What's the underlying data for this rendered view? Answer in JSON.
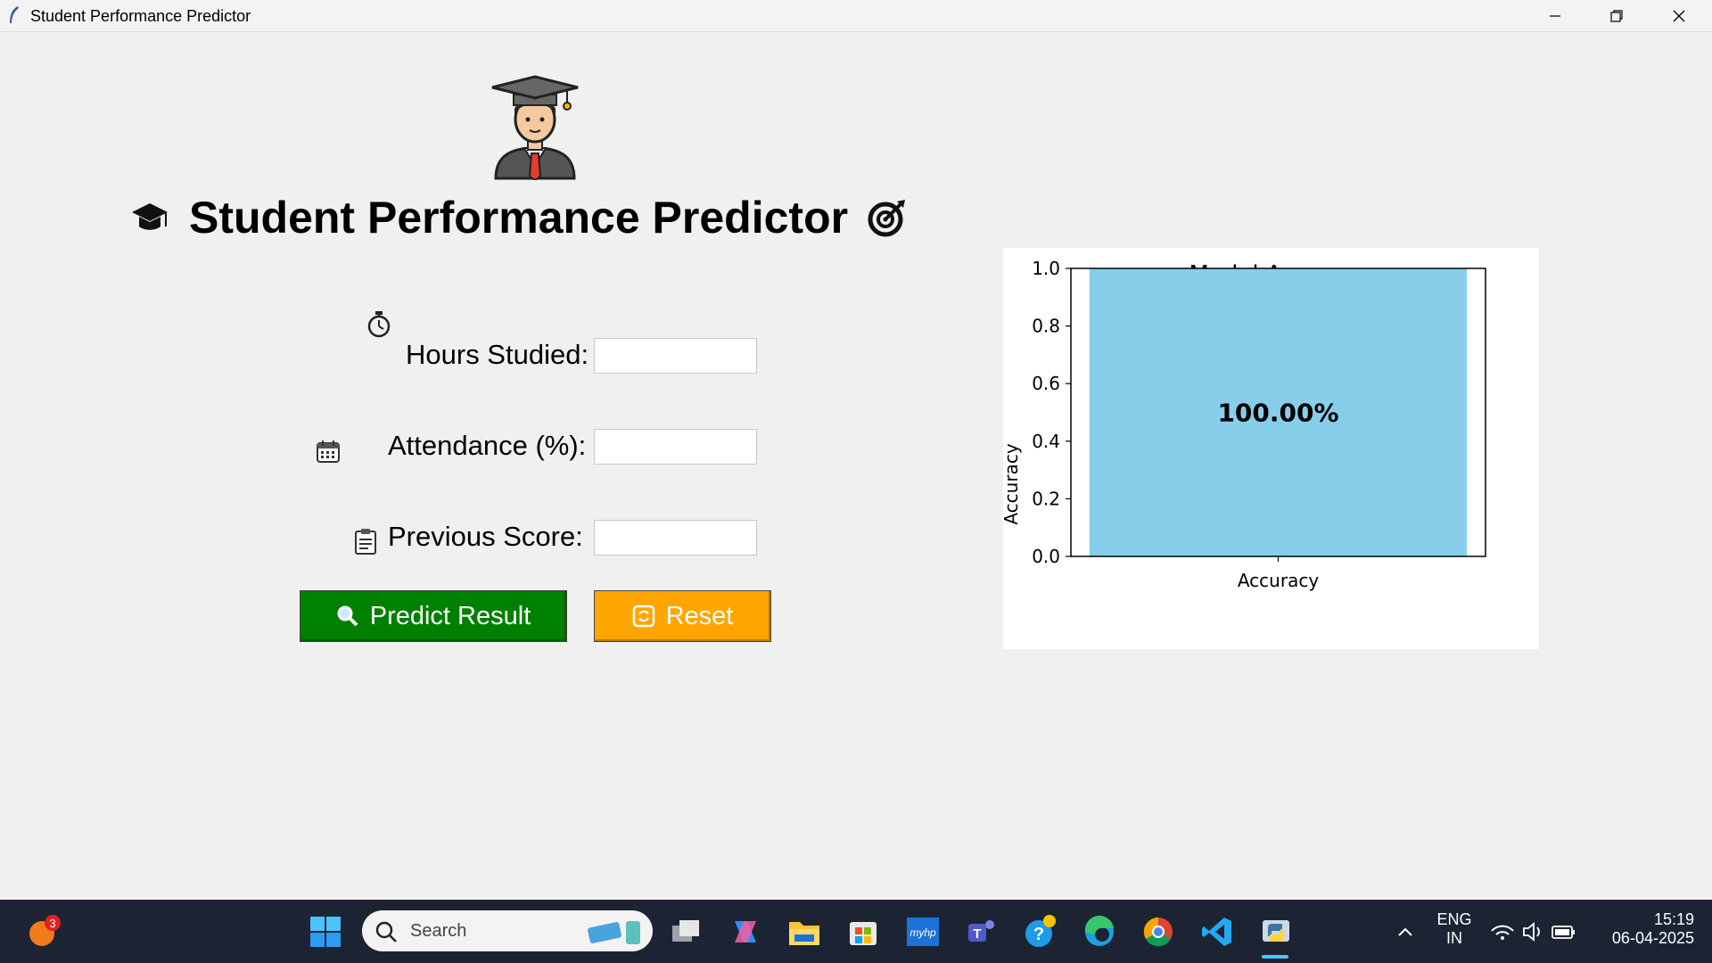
{
  "window": {
    "title": "Student Performance Predictor"
  },
  "app": {
    "heading": "Student Performance Predictor",
    "fields": [
      {
        "label": "Hours Studied:",
        "value": ""
      },
      {
        "label": "Attendance (%):",
        "value": ""
      },
      {
        "label": "Previous Score:",
        "value": ""
      }
    ],
    "buttons": {
      "predict_label": "Predict Result",
      "reset_label": "Reset"
    },
    "colors": {
      "predict_bg": "#008000",
      "reset_bg": "#ffa500",
      "bar": "#87ceeb"
    }
  },
  "chart_data": {
    "type": "bar",
    "title": "Model Accuracy",
    "categories": [
      "Accuracy"
    ],
    "values": [
      1.0
    ],
    "value_label": "100.00%",
    "xlabel": "Accuracy",
    "ylabel": "Accuracy",
    "ylim": [
      0,
      1.0
    ],
    "yticks": [
      "0.0",
      "0.2",
      "0.4",
      "0.6",
      "0.8",
      "1.0"
    ],
    "grid": false,
    "color": "#87ceeb"
  },
  "taskbar": {
    "search_placeholder": "Search",
    "notification_count": "3",
    "language": "ENG",
    "region": "IN",
    "time": "15:19",
    "date": "06-04-2025"
  }
}
